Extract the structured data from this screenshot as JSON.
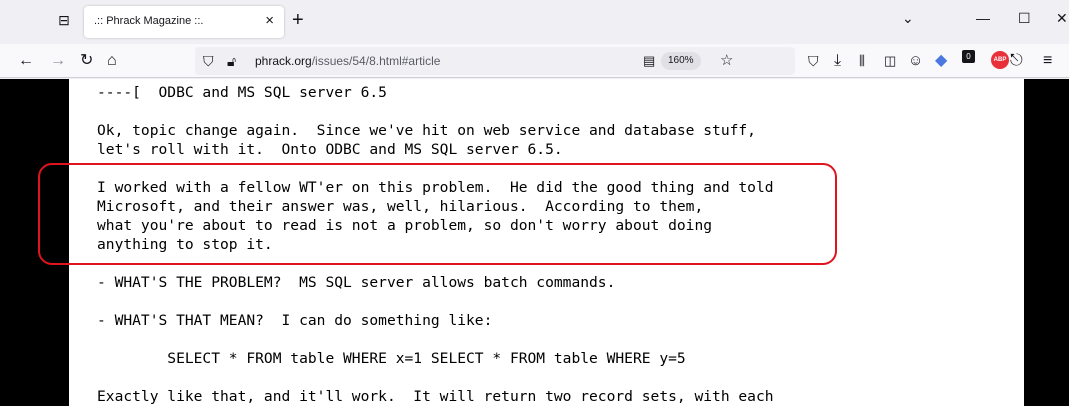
{
  "tab": {
    "title": ".:: Phrack Magazine ::.",
    "close_glyph": "×",
    "new_tab_glyph": "+"
  },
  "window_controls": {
    "chevron": "⌄",
    "minimize": "—",
    "maximize": "☐",
    "close": "✕"
  },
  "nav": {
    "zoom": "160%"
  },
  "url": {
    "host": "phrack.org",
    "path": "/issues/54/8.html#article"
  },
  "extensions": {
    "badge_count": "0",
    "abp_label": "ABP"
  },
  "article": {
    "lines": [
      "----[  ODBC and MS SQL server 6.5",
      "Ok, topic change again.  Since we've hit on web service and database stuff,",
      "let's roll with it.  Onto ODBC and MS SQL server 6.5.",
      "I worked with a fellow WT'er on this problem.  He did the good thing and told",
      "Microsoft, and their answer was, well, hilarious.  According to them,",
      "what you're about to read is not a problem, so don't worry about doing",
      "anything to stop it.",
      "- WHAT'S THE PROBLEM?  MS SQL server allows batch commands.",
      "- WHAT'S THAT MEAN?  I can do something like:",
      "        SELECT * FROM table WHERE x=1 SELECT * FROM table WHERE y=5",
      "Exactly like that, and it'll work.  It will return two record sets, with each"
    ]
  },
  "colors": {
    "highlight_border": "#e0141e",
    "page_side_bg": "#000000"
  }
}
